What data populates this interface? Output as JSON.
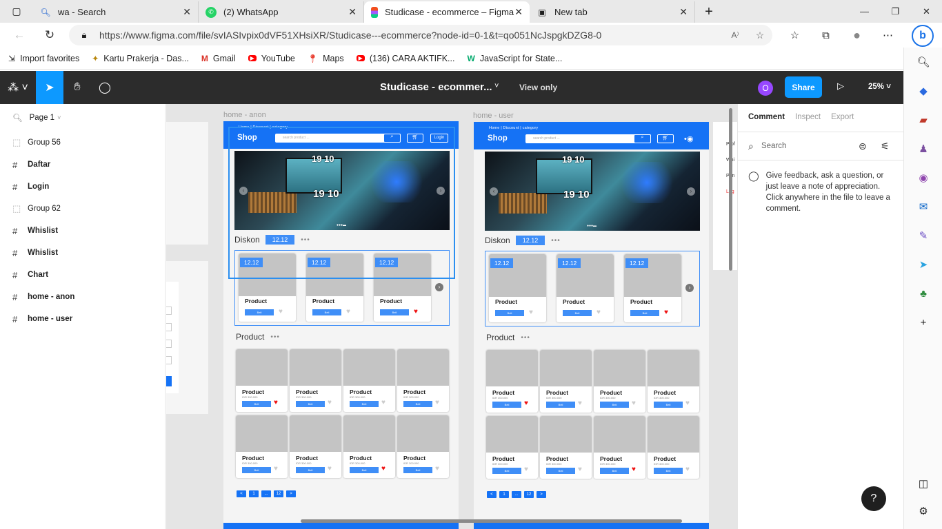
{
  "browser": {
    "tabs": [
      {
        "title": "wa - Search",
        "icon": "search-icon"
      },
      {
        "title": "(2) WhatsApp",
        "icon": "whatsapp-icon"
      },
      {
        "title": "Studicase - ecommerce – Figma",
        "icon": "figma-icon"
      },
      {
        "title": "New tab",
        "icon": "newtab-icon"
      }
    ],
    "url": "https://www.figma.com/file/svIASIvpix0dVF51XHsiXR/Studicase---ecommerce?node-id=0-1&t=qo051NcJspgkDZG8-0",
    "favorites": [
      "Import favorites",
      "Kartu Prakerja - Das...",
      "Gmail",
      "YouTube",
      "Maps",
      "(136) CARA AKTIFK...",
      "JavaScript for State..."
    ]
  },
  "figma": {
    "file_title": "Studicase - ecommer...",
    "view_only": "View only",
    "avatar_initial": "O",
    "share": "Share",
    "zoom": "25%",
    "page": "Page 1",
    "layers": [
      {
        "glyph": "⬚",
        "label": "Group 56",
        "bold": false
      },
      {
        "glyph": "#",
        "label": "Daftar",
        "bold": true
      },
      {
        "glyph": "#",
        "label": "Login",
        "bold": true
      },
      {
        "glyph": "⬚",
        "label": "Group 62",
        "bold": false
      },
      {
        "glyph": "#",
        "label": "Whislist",
        "bold": true
      },
      {
        "glyph": "#",
        "label": "Whislist",
        "bold": true
      },
      {
        "glyph": "#",
        "label": "Chart",
        "bold": true
      },
      {
        "glyph": "#",
        "label": "home - anon",
        "bold": true
      },
      {
        "glyph": "#",
        "label": "home - user",
        "bold": true
      }
    ],
    "right_panel": {
      "tabs": [
        "Comment",
        "Inspect",
        "Export"
      ],
      "search": "Search",
      "hint": "Give feedback, ask a question, or just leave a note of appreciation. Click anywhere in the file to leave a comment."
    }
  },
  "design": {
    "frame_anon": "home - anon",
    "frame_user": "home - user",
    "nav_links": "Home  |  Discount  |  category",
    "brand": "Shop",
    "search_placeholder": "search product ...",
    "login": "Login",
    "banner_num": "19 10",
    "diskon": "Diskon",
    "diskon_tag": "12.12",
    "more": "•••",
    "product_section": "Product",
    "product_name": "Product",
    "product_price": "IDR 300.000",
    "buy": "Beli",
    "pagination": [
      "<",
      "1",
      "...",
      "12",
      ">"
    ],
    "peek_items": [
      "Prof",
      "Whi",
      "Pen",
      "Log"
    ]
  }
}
